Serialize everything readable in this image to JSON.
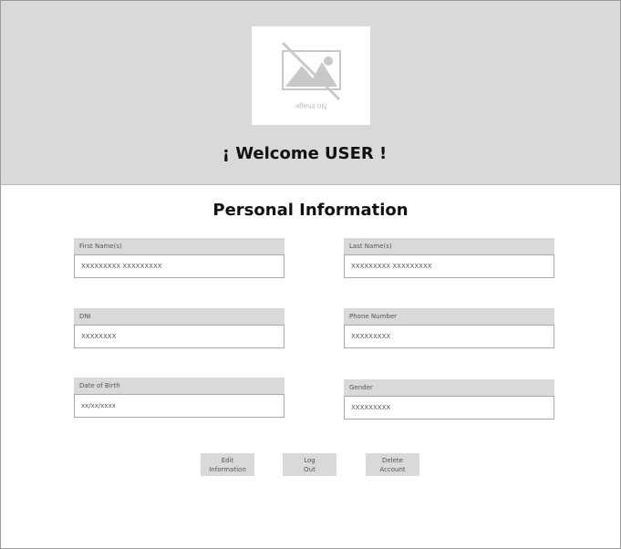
{
  "header": {
    "image_placeholder_text": "No image",
    "welcome_text": "¡ Welcome USER !"
  },
  "main": {
    "section_title": "Personal Information",
    "fields": [
      {
        "label": "First Name(s)",
        "value": "XXXXXXXXX XXXXXXXXX"
      },
      {
        "label": "Last Name(s)",
        "value": "XXXXXXXXX XXXXXXXXX"
      },
      {
        "label": "DNI",
        "value": "XXXXXXXX"
      },
      {
        "label": "Phone Number",
        "value": "XXXXXXXXX"
      },
      {
        "label": "Date of Birth",
        "value": "xx/xx/xxxx"
      },
      {
        "label": "Gender",
        "value": "XXXXXXXXX"
      }
    ],
    "buttons": {
      "edit": "Edit\nInformation",
      "logout": "Log\nOut",
      "delete": "Delete\nAccount"
    }
  }
}
